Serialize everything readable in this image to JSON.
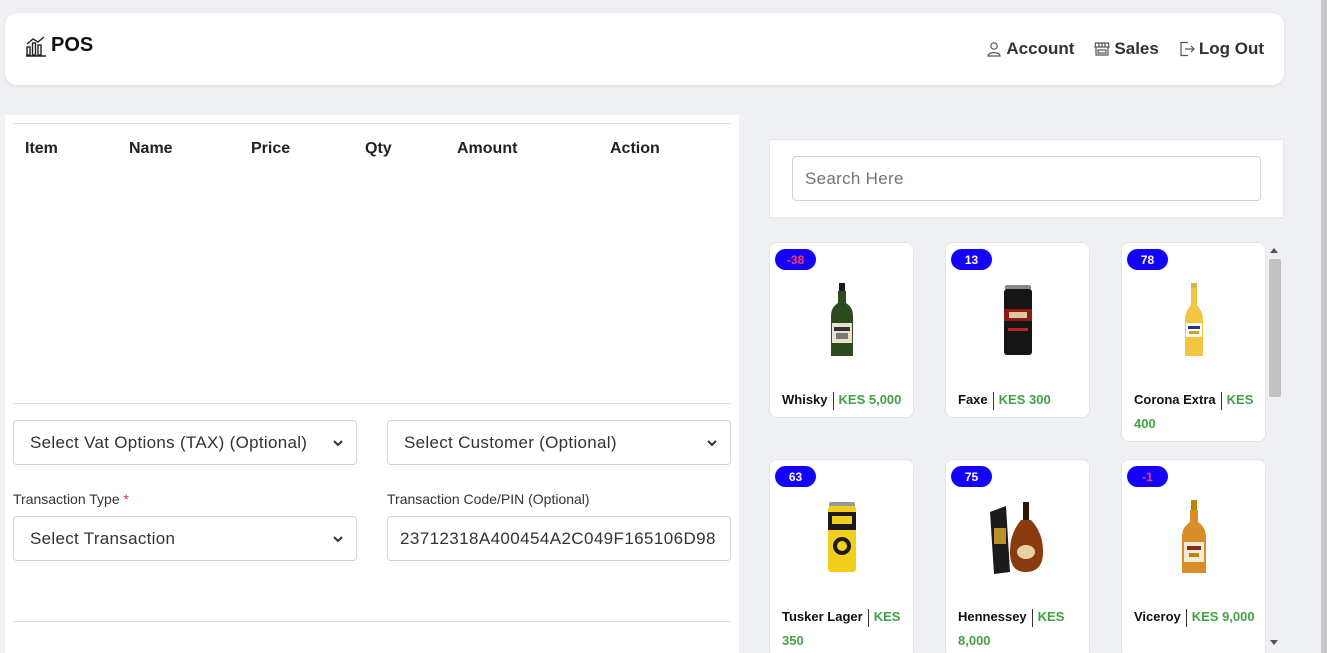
{
  "navbar": {
    "brand": "POS",
    "links": [
      {
        "label": "Account",
        "icon": "person-icon"
      },
      {
        "label": "Sales",
        "icon": "store-icon"
      },
      {
        "label": "Log Out",
        "icon": "logout-icon"
      }
    ]
  },
  "cart": {
    "columns": [
      "Item",
      "Name",
      "Price",
      "Qty",
      "Amount",
      "Action"
    ],
    "rows": []
  },
  "form": {
    "vat_select": "Select Vat Options (TAX) (Optional)",
    "customer_select": "Select Customer (Optional)",
    "transaction_type_label": "Transaction Type",
    "required_mark": "*",
    "transaction_select": "Select Transaction",
    "transaction_code_label": "Transaction Code/PIN (Optional)",
    "transaction_code_value": "23712318A400454A2C049F165106D98"
  },
  "search": {
    "placeholder": "Search Here"
  },
  "products": [
    {
      "name": "Whisky",
      "price": "KES 5,000",
      "stock": "-38",
      "negative": true
    },
    {
      "name": "Faxe",
      "price": "KES 300",
      "stock": "13",
      "negative": false
    },
    {
      "name": "Corona Extra",
      "price": "KES 400",
      "stock": "78",
      "negative": false
    },
    {
      "name": "Tusker Lager",
      "price": "KES 350",
      "stock": "63",
      "negative": false
    },
    {
      "name": "Hennessey",
      "price": "KES 8,000",
      "stock": "75",
      "negative": false
    },
    {
      "name": "Viceroy",
      "price": "KES 9,000",
      "stock": "-1",
      "negative": true
    }
  ],
  "colors": {
    "badge": "#1400ff",
    "price": "#43a047",
    "negative_stock": "#ff3b5c"
  }
}
